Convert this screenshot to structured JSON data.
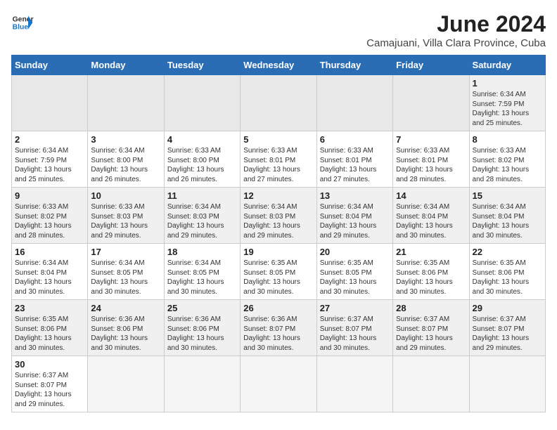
{
  "header": {
    "logo": {
      "line1": "General",
      "line2": "Blue"
    },
    "title": "June 2024",
    "location": "Camajuani, Villa Clara Province, Cuba"
  },
  "weekdays": [
    "Sunday",
    "Monday",
    "Tuesday",
    "Wednesday",
    "Thursday",
    "Friday",
    "Saturday"
  ],
  "weeks": [
    [
      {
        "day": "",
        "info": ""
      },
      {
        "day": "",
        "info": ""
      },
      {
        "day": "",
        "info": ""
      },
      {
        "day": "",
        "info": ""
      },
      {
        "day": "",
        "info": ""
      },
      {
        "day": "",
        "info": ""
      },
      {
        "day": "1",
        "info": "Sunrise: 6:34 AM\nSunset: 7:59 PM\nDaylight: 13 hours and 25 minutes."
      }
    ],
    [
      {
        "day": "2",
        "info": "Sunrise: 6:34 AM\nSunset: 7:59 PM\nDaylight: 13 hours and 25 minutes."
      },
      {
        "day": "3",
        "info": "Sunrise: 6:34 AM\nSunset: 8:00 PM\nDaylight: 13 hours and 26 minutes."
      },
      {
        "day": "4",
        "info": "Sunrise: 6:33 AM\nSunset: 8:00 PM\nDaylight: 13 hours and 26 minutes."
      },
      {
        "day": "5",
        "info": "Sunrise: 6:33 AM\nSunset: 8:01 PM\nDaylight: 13 hours and 27 minutes."
      },
      {
        "day": "6",
        "info": "Sunrise: 6:33 AM\nSunset: 8:01 PM\nDaylight: 13 hours and 27 minutes."
      },
      {
        "day": "7",
        "info": "Sunrise: 6:33 AM\nSunset: 8:01 PM\nDaylight: 13 hours and 28 minutes."
      },
      {
        "day": "8",
        "info": "Sunrise: 6:33 AM\nSunset: 8:02 PM\nDaylight: 13 hours and 28 minutes."
      }
    ],
    [
      {
        "day": "9",
        "info": "Sunrise: 6:33 AM\nSunset: 8:02 PM\nDaylight: 13 hours and 28 minutes."
      },
      {
        "day": "10",
        "info": "Sunrise: 6:33 AM\nSunset: 8:03 PM\nDaylight: 13 hours and 29 minutes."
      },
      {
        "day": "11",
        "info": "Sunrise: 6:34 AM\nSunset: 8:03 PM\nDaylight: 13 hours and 29 minutes."
      },
      {
        "day": "12",
        "info": "Sunrise: 6:34 AM\nSunset: 8:03 PM\nDaylight: 13 hours and 29 minutes."
      },
      {
        "day": "13",
        "info": "Sunrise: 6:34 AM\nSunset: 8:04 PM\nDaylight: 13 hours and 29 minutes."
      },
      {
        "day": "14",
        "info": "Sunrise: 6:34 AM\nSunset: 8:04 PM\nDaylight: 13 hours and 30 minutes."
      },
      {
        "day": "15",
        "info": "Sunrise: 6:34 AM\nSunset: 8:04 PM\nDaylight: 13 hours and 30 minutes."
      }
    ],
    [
      {
        "day": "16",
        "info": "Sunrise: 6:34 AM\nSunset: 8:04 PM\nDaylight: 13 hours and 30 minutes."
      },
      {
        "day": "17",
        "info": "Sunrise: 6:34 AM\nSunset: 8:05 PM\nDaylight: 13 hours and 30 minutes."
      },
      {
        "day": "18",
        "info": "Sunrise: 6:34 AM\nSunset: 8:05 PM\nDaylight: 13 hours and 30 minutes."
      },
      {
        "day": "19",
        "info": "Sunrise: 6:35 AM\nSunset: 8:05 PM\nDaylight: 13 hours and 30 minutes."
      },
      {
        "day": "20",
        "info": "Sunrise: 6:35 AM\nSunset: 8:05 PM\nDaylight: 13 hours and 30 minutes."
      },
      {
        "day": "21",
        "info": "Sunrise: 6:35 AM\nSunset: 8:06 PM\nDaylight: 13 hours and 30 minutes."
      },
      {
        "day": "22",
        "info": "Sunrise: 6:35 AM\nSunset: 8:06 PM\nDaylight: 13 hours and 30 minutes."
      }
    ],
    [
      {
        "day": "23",
        "info": "Sunrise: 6:35 AM\nSunset: 8:06 PM\nDaylight: 13 hours and 30 minutes."
      },
      {
        "day": "24",
        "info": "Sunrise: 6:36 AM\nSunset: 8:06 PM\nDaylight: 13 hours and 30 minutes."
      },
      {
        "day": "25",
        "info": "Sunrise: 6:36 AM\nSunset: 8:06 PM\nDaylight: 13 hours and 30 minutes."
      },
      {
        "day": "26",
        "info": "Sunrise: 6:36 AM\nSunset: 8:07 PM\nDaylight: 13 hours and 30 minutes."
      },
      {
        "day": "27",
        "info": "Sunrise: 6:37 AM\nSunset: 8:07 PM\nDaylight: 13 hours and 30 minutes."
      },
      {
        "day": "28",
        "info": "Sunrise: 6:37 AM\nSunset: 8:07 PM\nDaylight: 13 hours and 29 minutes."
      },
      {
        "day": "29",
        "info": "Sunrise: 6:37 AM\nSunset: 8:07 PM\nDaylight: 13 hours and 29 minutes."
      }
    ],
    [
      {
        "day": "30",
        "info": "Sunrise: 6:37 AM\nSunset: 8:07 PM\nDaylight: 13 hours and 29 minutes."
      },
      {
        "day": "",
        "info": ""
      },
      {
        "day": "",
        "info": ""
      },
      {
        "day": "",
        "info": ""
      },
      {
        "day": "",
        "info": ""
      },
      {
        "day": "",
        "info": ""
      },
      {
        "day": "",
        "info": ""
      }
    ]
  ]
}
